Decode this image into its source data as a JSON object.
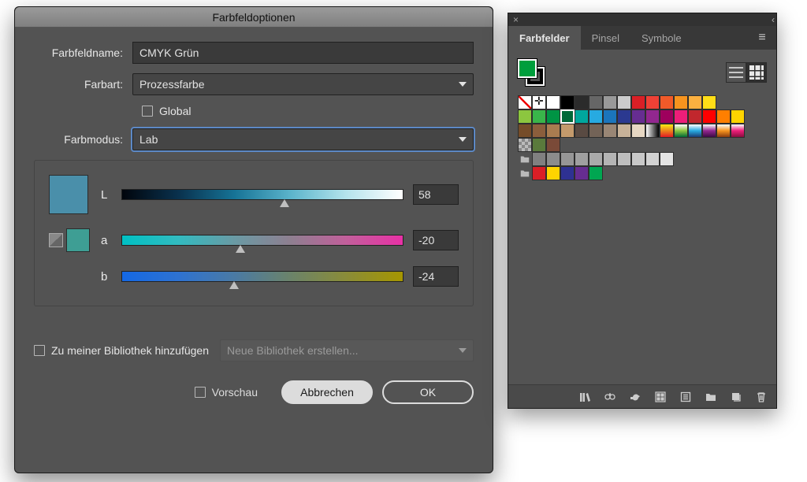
{
  "dialog": {
    "title": "Farbfeldoptionen",
    "labels": {
      "name": "Farbfeldname:",
      "type": "Farbart:",
      "global": "Global",
      "mode": "Farbmodus:",
      "addlib": "Zu meiner Bibliothek hinzufügen",
      "preview": "Vorschau"
    },
    "values": {
      "name": "CMYK Grün",
      "type": "Prozessfarbe",
      "mode": "Lab",
      "lib_placeholder": "Neue Bibliothek erstellen..."
    },
    "sliders": {
      "L": {
        "label": "L",
        "value": "58",
        "pos": 58
      },
      "a": {
        "label": "a",
        "value": "-20",
        "pos": 42
      },
      "b": {
        "label": "b",
        "value": "-24",
        "pos": 40
      }
    },
    "buttons": {
      "cancel": "Abbrechen",
      "ok": "OK"
    },
    "preview_color": "#4a8faa",
    "preview_small_color": "#3e9e94"
  },
  "panel": {
    "tabs": [
      "Farbfelder",
      "Pinsel",
      "Symbole"
    ],
    "active_tab": 0,
    "fill_color": "#009e3c",
    "stroke_color": "#000000",
    "rows": [
      [
        "none",
        "reg",
        "#ffffff",
        "#000000",
        "#2b2b2b",
        "#666666",
        "#999999",
        "#cccccc",
        "#da1f26",
        "#ef4136",
        "#f15a29",
        "#f7941e",
        "#fbb040",
        "#ffde17"
      ],
      [
        "#8cc63f",
        "#39b54a",
        "#009444",
        "sel:#006838",
        "#00a79d",
        "#27aae1",
        "#1b75bc",
        "#2b3990",
        "#662d91",
        "#92278f",
        "#9e005d",
        "#ed1e79",
        "#c1272d",
        "#ff0000",
        "#ff7f00",
        "#ffd400"
      ],
      [
        "#754c29",
        "#8b5e3c",
        "#a97c50",
        "#c49a6c",
        "#594a42",
        "#736357",
        "#998675",
        "#c7b299",
        "#e6d7c3",
        "grad1",
        "grad2",
        "grad3",
        "grad4",
        "grad5",
        "grad6",
        "grad7"
      ],
      [
        "checker",
        "#5a7a3c",
        "#7a4a38"
      ],
      [
        "folder",
        "#808080",
        "#8c8c8c",
        "#969696",
        "#a0a0a0",
        "#aaaaaa",
        "#b4b4b4",
        "#bebebe",
        "#c8c8c8",
        "#d2d2d2",
        "#e4e4e4"
      ],
      [
        "folder",
        "#da1f26",
        "#ffd400",
        "#2e3192",
        "#662d91",
        "#00a651"
      ]
    ],
    "gradients": {
      "grad1": "linear-gradient(90deg,#fff,#000)",
      "grad2": "linear-gradient(#f7ec13,#e31b23)",
      "grad3": "linear-gradient(#fff,#8cc63f,#006838)",
      "grad4": "linear-gradient(#fff,#27aae1,#1b3c73)",
      "grad5": "linear-gradient(#fff,#92278f,#3b0a45)",
      "grad6": "linear-gradient(#fff,#f7941e,#8a3a0e)",
      "grad7": "linear-gradient(#fff,#ed1e79,#8a0e3f)"
    }
  }
}
